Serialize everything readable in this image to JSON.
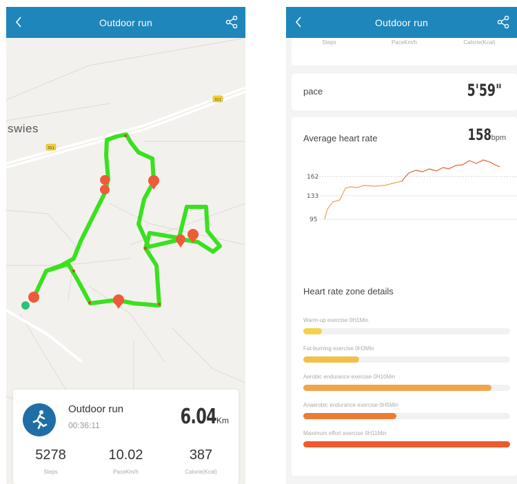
{
  "left_screen": {
    "header": {
      "title": "Outdoor run"
    },
    "map": {
      "place_label": "swies",
      "road_badges": [
        "311",
        "311"
      ]
    },
    "summary": {
      "activity": "Outdoor run",
      "duration": "00:36:11",
      "distance_value": "6.04",
      "distance_unit": "Km",
      "stats": [
        {
          "value": "5278",
          "label": "Steps"
        },
        {
          "value": "10.02",
          "label": "PaceKm/h"
        },
        {
          "value": "387",
          "label": "Calorie(Kcal)"
        }
      ]
    }
  },
  "right_screen": {
    "header": {
      "title": "Outdoor run"
    },
    "top_labels": [
      "Steps",
      "PaceKm/h",
      "Calorie(Kcal)"
    ],
    "pace": {
      "label": "pace",
      "value": "5'59\""
    },
    "heart_rate": {
      "label": "Average heart rate",
      "value": "158",
      "unit": "bpm",
      "y_ticks": [
        "162",
        "133",
        "95"
      ]
    },
    "zones": {
      "title": "Heart rate zone details",
      "items": [
        {
          "label": "Warm-up exercise 0H1Min",
          "fraction": 0.09,
          "color": "#f6d24a"
        },
        {
          "label": "Fat-burning exercise 0H3Min",
          "fraction": 0.27,
          "color": "#f3c04a"
        },
        {
          "label": "Aerobic endurance exercise 0H10Min",
          "fraction": 0.91,
          "color": "#f1a54a"
        },
        {
          "label": "Anaerobic endurance exercise 0H5Min",
          "fraction": 0.45,
          "color": "#ee7a35"
        },
        {
          "label": "Maximum effort exercise 0H11Min",
          "fraction": 1.0,
          "color": "#ec5a2e"
        }
      ]
    }
  },
  "colors": {
    "header": "#1e86ba",
    "route": "#39e11f",
    "marker": "#ee5a3a"
  }
}
